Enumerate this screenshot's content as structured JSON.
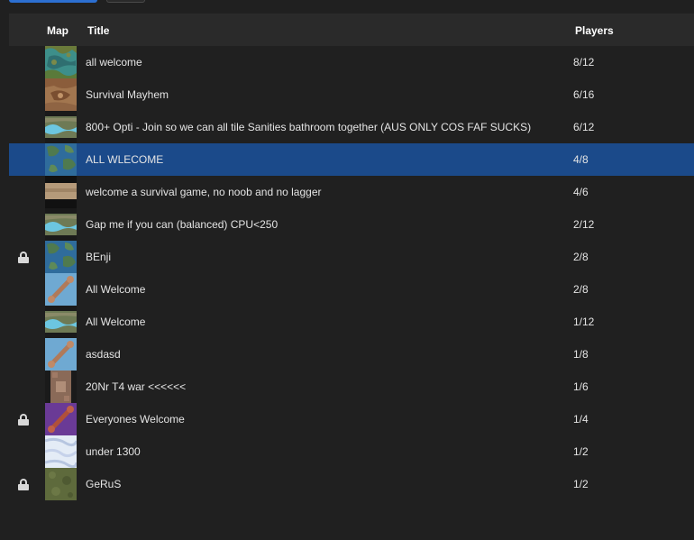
{
  "header": {
    "map": "Map",
    "title": "Title",
    "players": "Players"
  },
  "rows": [
    {
      "title": "all welcome",
      "players": "8/12",
      "locked": false,
      "thumb": "lakes-icon"
    },
    {
      "title": "Survival Mayhem",
      "players": "6/16",
      "locked": false,
      "thumb": "canyon-icon"
    },
    {
      "title": "800+ Opti - Join so we can all tile Sanities bathroom together (AUS ONLY COS FAF SUCKS)",
      "players": "6/12",
      "locked": false,
      "thumb": "river-icon"
    },
    {
      "title": "ALL WLECOME",
      "players": "4/8",
      "locked": false,
      "thumb": "islands-icon"
    },
    {
      "title": "welcome a survival game, no noob and no lagger",
      "players": "4/6",
      "locked": false,
      "thumb": "strip-icon"
    },
    {
      "title": "Gap me if you can (balanced) CPU<250",
      "players": "2/12",
      "locked": false,
      "thumb": "river-icon"
    },
    {
      "title": "BEnji",
      "players": "2/8",
      "locked": true,
      "thumb": "islands-icon"
    },
    {
      "title": "All Welcome",
      "players": "2/8",
      "locked": false,
      "thumb": "bridge-icon"
    },
    {
      "title": "All Welcome",
      "players": "1/12",
      "locked": false,
      "thumb": "river-icon"
    },
    {
      "title": "asdasd",
      "players": "1/8",
      "locked": false,
      "thumb": "bridge-icon"
    },
    {
      "title": "20Nr T4 war <<<<<<",
      "players": "1/6",
      "locked": false,
      "thumb": "fortress-icon"
    },
    {
      "title": "Everyones Welcome",
      "players": "1/4",
      "locked": true,
      "thumb": "purple-bridge-icon"
    },
    {
      "title": "under 1300",
      "players": "1/2",
      "locked": false,
      "thumb": "snow-icon"
    },
    {
      "title": "GeRuS",
      "players": "1/2",
      "locked": true,
      "thumb": "grassland-icon"
    }
  ],
  "selected_index": 3
}
